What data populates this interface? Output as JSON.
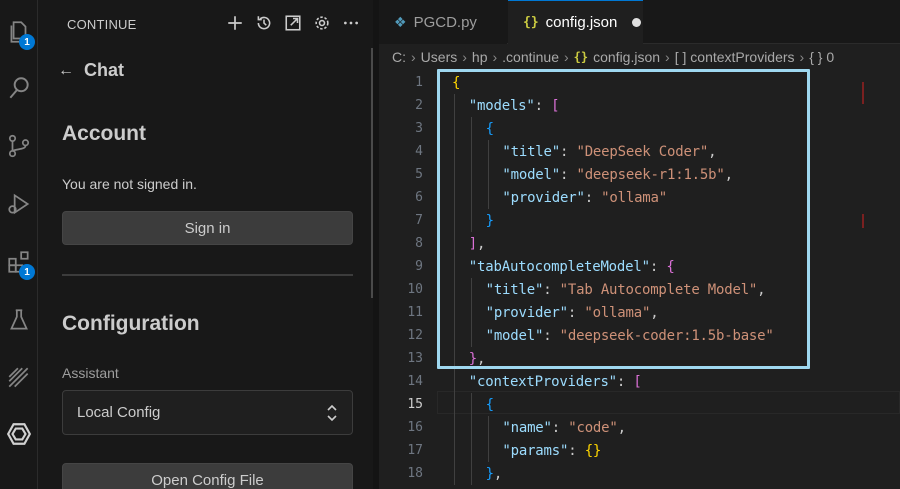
{
  "activity_bar": {
    "items": [
      {
        "name": "explorer",
        "badge": "1"
      },
      {
        "name": "search"
      },
      {
        "name": "source-control"
      },
      {
        "name": "run-debug"
      },
      {
        "name": "extensions",
        "badge": "1"
      },
      {
        "name": "testing"
      },
      {
        "name": "remote"
      },
      {
        "name": "continue"
      }
    ]
  },
  "panel": {
    "title": "CONTINUE",
    "back_label": "Chat",
    "account_heading": "Account",
    "signed_out_text": "You are not signed in.",
    "sign_in_label": "Sign in",
    "configuration_heading": "Configuration",
    "assistant_label": "Assistant",
    "assistant_value": "Local Config",
    "open_config_label": "Open Config File"
  },
  "tabs": [
    {
      "label": "PGCD.py",
      "icon": "python-icon"
    },
    {
      "label": "config.json",
      "icon": "json-braces-icon",
      "modified": true
    }
  ],
  "breadcrumbs": {
    "items": [
      "C:",
      "Users",
      "hp",
      ".continue",
      "config.json",
      "[ ] contextProviders",
      "{ } 0"
    ]
  },
  "editor": {
    "active_line": 15,
    "lines": [
      {
        "n": "1",
        "tokens": [
          {
            "t": "{",
            "c": "b1"
          }
        ]
      },
      {
        "n": "2",
        "tokens": [
          {
            "t": "\"models\"",
            "c": "k"
          },
          {
            "t": ": ",
            "c": "p"
          },
          {
            "t": "[",
            "c": "b2"
          }
        ]
      },
      {
        "n": "3",
        "tokens": [
          {
            "t": "{",
            "c": "b3"
          }
        ]
      },
      {
        "n": "4",
        "tokens": [
          {
            "t": "\"title\"",
            "c": "k"
          },
          {
            "t": ": ",
            "c": "p"
          },
          {
            "t": "\"DeepSeek Coder\"",
            "c": "s"
          },
          {
            "t": ",",
            "c": "p"
          }
        ]
      },
      {
        "n": "5",
        "tokens": [
          {
            "t": "\"model\"",
            "c": "k"
          },
          {
            "t": ": ",
            "c": "p"
          },
          {
            "t": "\"deepseek-r1:1.5b\"",
            "c": "s"
          },
          {
            "t": ",",
            "c": "p"
          }
        ]
      },
      {
        "n": "6",
        "tokens": [
          {
            "t": "\"provider\"",
            "c": "k"
          },
          {
            "t": ": ",
            "c": "p"
          },
          {
            "t": "\"ollama\"",
            "c": "s"
          }
        ]
      },
      {
        "n": "7",
        "tokens": [
          {
            "t": "}",
            "c": "b3"
          }
        ]
      },
      {
        "n": "8",
        "tokens": [
          {
            "t": "]",
            "c": "b2"
          },
          {
            "t": ",",
            "c": "p"
          }
        ]
      },
      {
        "n": "9",
        "tokens": [
          {
            "t": "\"tabAutocompleteModel\"",
            "c": "k"
          },
          {
            "t": ": ",
            "c": "p"
          },
          {
            "t": "{",
            "c": "b2"
          }
        ]
      },
      {
        "n": "10",
        "tokens": [
          {
            "t": "\"title\"",
            "c": "k"
          },
          {
            "t": ": ",
            "c": "p"
          },
          {
            "t": "\"Tab Autocomplete Model\"",
            "c": "s"
          },
          {
            "t": ",",
            "c": "p"
          }
        ]
      },
      {
        "n": "11",
        "tokens": [
          {
            "t": "\"provider\"",
            "c": "k"
          },
          {
            "t": ": ",
            "c": "p"
          },
          {
            "t": "\"ollama\"",
            "c": "s"
          },
          {
            "t": ",",
            "c": "p"
          }
        ]
      },
      {
        "n": "12",
        "tokens": [
          {
            "t": "\"model\"",
            "c": "k"
          },
          {
            "t": ": ",
            "c": "p"
          },
          {
            "t": "\"deepseek-coder:1.5b-base\"",
            "c": "s"
          }
        ]
      },
      {
        "n": "13",
        "tokens": [
          {
            "t": "}",
            "c": "b2"
          },
          {
            "t": ",",
            "c": "p"
          }
        ]
      },
      {
        "n": "14",
        "tokens": [
          {
            "t": "\"contextProviders\"",
            "c": "k"
          },
          {
            "t": ": ",
            "c": "p"
          },
          {
            "t": "[",
            "c": "b2"
          }
        ]
      },
      {
        "n": "15",
        "tokens": [
          {
            "t": "{",
            "c": "b3"
          }
        ]
      },
      {
        "n": "16",
        "tokens": [
          {
            "t": "\"name\"",
            "c": "k"
          },
          {
            "t": ": ",
            "c": "p"
          },
          {
            "t": "\"code\"",
            "c": "s"
          },
          {
            "t": ",",
            "c": "p"
          }
        ]
      },
      {
        "n": "17",
        "tokens": [
          {
            "t": "\"params\"",
            "c": "k"
          },
          {
            "t": ": ",
            "c": "p"
          },
          {
            "t": "{}",
            "c": "b1"
          }
        ]
      },
      {
        "n": "18",
        "tokens": [
          {
            "t": "}",
            "c": "b3"
          },
          {
            "t": ",",
            "c": "p"
          }
        ]
      }
    ]
  }
}
